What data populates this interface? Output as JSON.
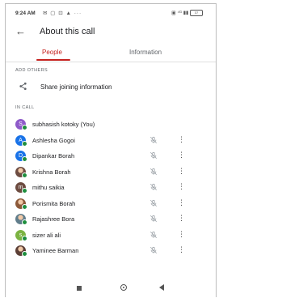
{
  "status": {
    "time": "9:24 AM",
    "left_icons": "✉ ▢ ⊡ ▲ ···",
    "right_icons": "▣ ⁴ᴳ ▮▮ ",
    "battery": "37"
  },
  "header": {
    "title": "About this call"
  },
  "tabs": [
    {
      "label": "People",
      "active": true
    },
    {
      "label": "Information",
      "active": false
    }
  ],
  "add_others": {
    "section_label": "ADD OTHERS",
    "share_label": "Share joining information"
  },
  "in_call": {
    "section_label": "IN CALL",
    "participants": [
      {
        "name": "subhasish kotoky (You)",
        "initial": "S",
        "color": "#8e5ac9",
        "photo": false,
        "muted": false
      },
      {
        "name": "Ashlesha Gogoi",
        "initial": "A",
        "color": "#1a73e8",
        "photo": false,
        "muted": true
      },
      {
        "name": "Dipankar Borah",
        "initial": "D",
        "color": "#1a73e8",
        "photo": false,
        "muted": true
      },
      {
        "name": "Krishna Borah",
        "initial": "",
        "color": "#6d4c41",
        "photo": true,
        "muted": true
      },
      {
        "name": "mithu saikia",
        "initial": "m",
        "color": "#6d4c41",
        "photo": false,
        "muted": true
      },
      {
        "name": "Porismita Borah",
        "initial": "",
        "color": "#8d5a3a",
        "photo": true,
        "muted": true
      },
      {
        "name": "Rajashree Bora",
        "initial": "",
        "color": "#607d8b",
        "photo": true,
        "muted": true
      },
      {
        "name": "sizer ali ali",
        "initial": "s",
        "color": "#7cb342",
        "photo": false,
        "muted": true
      },
      {
        "name": "Yaminee Barman",
        "initial": "",
        "color": "#5d4037",
        "photo": true,
        "muted": true
      }
    ]
  },
  "colors": {
    "accent": "#c5221f",
    "online": "#1e8e3e",
    "text": "#202124",
    "muted_text": "#5f6368"
  },
  "icons": {
    "back": "arrow-left-icon",
    "share": "share-icon",
    "mic_off": "mic-off-icon",
    "more": "more-vert-icon"
  }
}
